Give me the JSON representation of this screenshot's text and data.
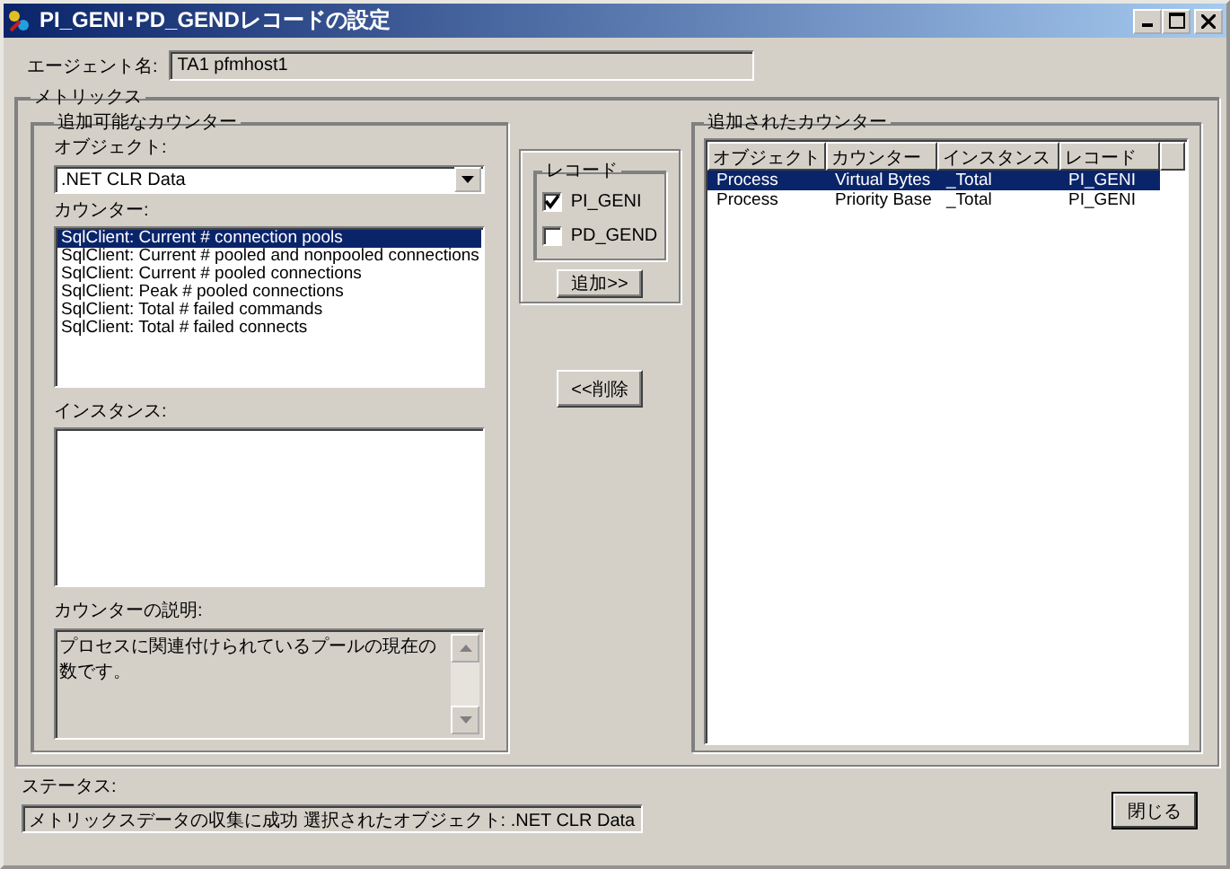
{
  "window": {
    "title": "PI_GENI･PD_GENDレコードの設定"
  },
  "agent": {
    "label": "エージェント名:",
    "value": "TA1 pfmhost1"
  },
  "metrics": {
    "title": "メトリックス",
    "available": {
      "title": "追加可能なカウンター",
      "object_label": "オブジェクト:",
      "object_value": ".NET CLR Data",
      "counter_label": "カウンター:",
      "counters": [
        {
          "text": "SqlClient: Current # connection pools",
          "selected": true
        },
        {
          "text": "SqlClient: Current # pooled and nonpooled connections",
          "selected": false
        },
        {
          "text": "SqlClient: Current # pooled connections",
          "selected": false
        },
        {
          "text": "SqlClient: Peak # pooled connections",
          "selected": false
        },
        {
          "text": "SqlClient: Total # failed commands",
          "selected": false
        },
        {
          "text": "SqlClient: Total # failed connects",
          "selected": false
        }
      ],
      "instance_label": "インスタンス:",
      "description_label": "カウンターの説明:",
      "description": "プロセスに関連付けられているプールの現在の数です。"
    },
    "record": {
      "title": "レコード",
      "options": [
        {
          "label": "PI_GENI",
          "checked": true
        },
        {
          "label": "PD_GEND",
          "checked": false
        }
      ]
    },
    "add_button": "追加>>",
    "remove_button": "<<削除",
    "added": {
      "title": "追加されたカウンター",
      "columns": [
        "オブジェクト",
        "カウンター",
        "インスタンス",
        "レコード"
      ],
      "rows": [
        {
          "cells": [
            "Process",
            "Virtual Bytes",
            "_Total",
            "PI_GENI"
          ],
          "selected": true
        },
        {
          "cells": [
            "Process",
            "Priority Base",
            "_Total",
            "PI_GENI"
          ],
          "selected": false
        }
      ]
    }
  },
  "status": {
    "label": "ステータス:",
    "text": "メトリックスデータの収集に成功  選択されたオブジェクト: .NET CLR Data"
  },
  "close_button": "閉じる"
}
